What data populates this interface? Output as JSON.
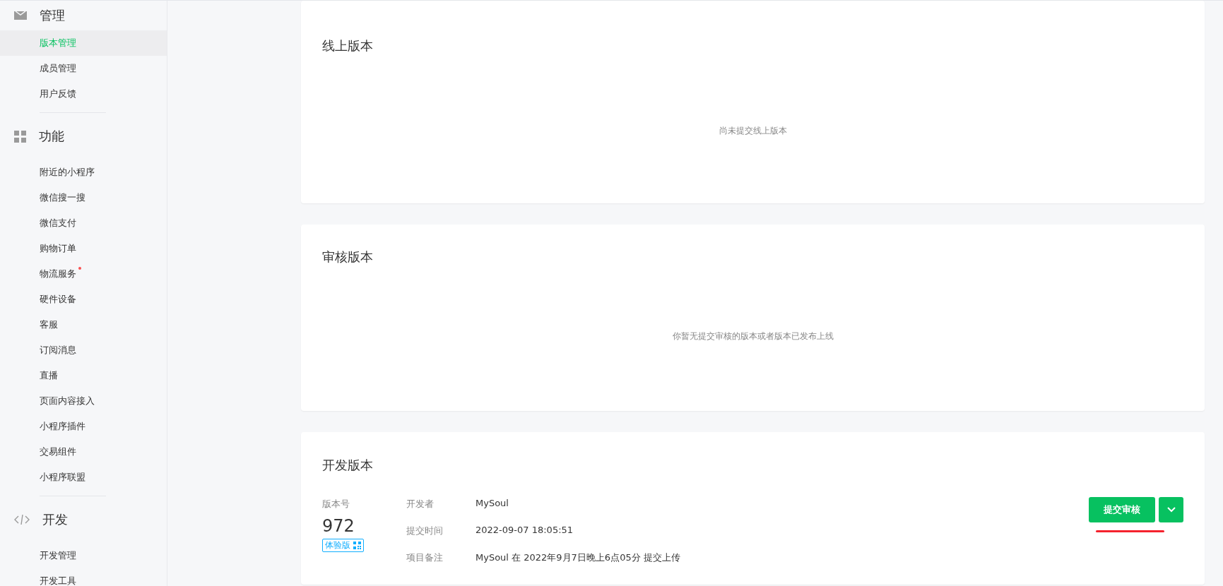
{
  "sidebar": {
    "groups": [
      {
        "kind": "mail",
        "label": "管理",
        "items": [
          {
            "label": "版本管理",
            "selected": true,
            "dot": false
          },
          {
            "label": "成员管理",
            "selected": false,
            "dot": false
          },
          {
            "label": "用户反馈",
            "selected": false,
            "dot": false
          }
        ]
      },
      {
        "kind": "grid",
        "label": "功能",
        "items": [
          {
            "label": "附近的小程序",
            "selected": false,
            "dot": false
          },
          {
            "label": "微信搜一搜",
            "selected": false,
            "dot": false
          },
          {
            "label": "微信支付",
            "selected": false,
            "dot": false
          },
          {
            "label": "购物订单",
            "selected": false,
            "dot": false
          },
          {
            "label": "物流服务",
            "selected": false,
            "dot": true
          },
          {
            "label": "硬件设备",
            "selected": false,
            "dot": false
          },
          {
            "label": "客服",
            "selected": false,
            "dot": false
          },
          {
            "label": "订阅消息",
            "selected": false,
            "dot": false
          },
          {
            "label": "直播",
            "selected": false,
            "dot": false
          },
          {
            "label": "页面内容接入",
            "selected": false,
            "dot": false
          },
          {
            "label": "小程序插件",
            "selected": false,
            "dot": false
          },
          {
            "label": "交易组件",
            "selected": false,
            "dot": false
          },
          {
            "label": "小程序联盟",
            "selected": false,
            "dot": false
          }
        ]
      },
      {
        "kind": "code",
        "label": "开发",
        "items": [
          {
            "label": "开发管理",
            "selected": false,
            "dot": false
          },
          {
            "label": "开发工具",
            "selected": false,
            "dot": false
          }
        ]
      }
    ]
  },
  "online": {
    "title": "线上版本",
    "empty": "尚未提交线上版本"
  },
  "review": {
    "title": "审核版本",
    "empty": "你暂无提交审核的版本或者版本已发布上线"
  },
  "dev": {
    "title": "开发版本",
    "version_label": "版本号",
    "version": "972",
    "badge": "体验版",
    "fields": [
      {
        "label": "开发者",
        "value": "MySoul"
      },
      {
        "label": "提交时间",
        "value": "2022-09-07 18:05:51"
      },
      {
        "label": "项目备注",
        "value": "MySoul 在 2022年9月7日晚上6点05分 提交上传"
      }
    ],
    "submit_button": "提交审核"
  }
}
